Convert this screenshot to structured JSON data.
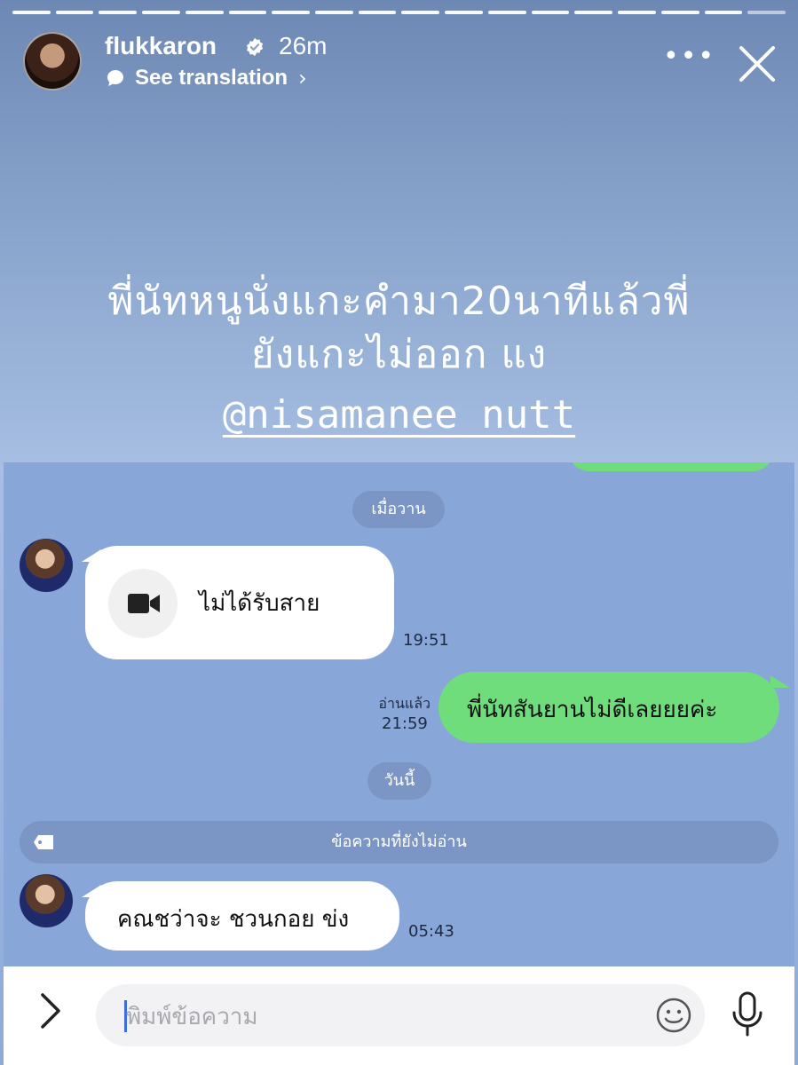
{
  "story": {
    "progress_segments": 18,
    "progress_done": 17,
    "username": "flukkaron",
    "verified": true,
    "posted_ago": "26m",
    "translate_label": "See translation",
    "translate_chevron": "›",
    "more_label": "•••",
    "caption_line1": "พี่นัทหนูนั่งแกะคำมา20นาทีแล้วพี่",
    "caption_line2": "ยังแกะไม่ออก แง",
    "mention": "@nisamanee_nutt"
  },
  "chat": {
    "date_yesterday": "เมื่อวาน",
    "missed_call_label": "ไม่ได้รับสาย",
    "missed_call_time": "19:51",
    "outgoing_read": "อ่านแล้ว",
    "outgoing_time": "21:59",
    "outgoing_text": "พี่นัทสันยานไม่ดีเลยยยค่ะ",
    "date_today": "วันนี้",
    "unread_label": "ข้อความที่ยังไม่อ่าน",
    "incoming_text": "คณชว่าจะ ชวนกอย ข่ง",
    "incoming_time": "05:43"
  },
  "input": {
    "placeholder": "พิมพ์ข้อความ"
  },
  "colors": {
    "green_bubble": "#6fdd7b",
    "chat_bg": "#88a7d8",
    "pill_bg": "#7b95c4"
  }
}
